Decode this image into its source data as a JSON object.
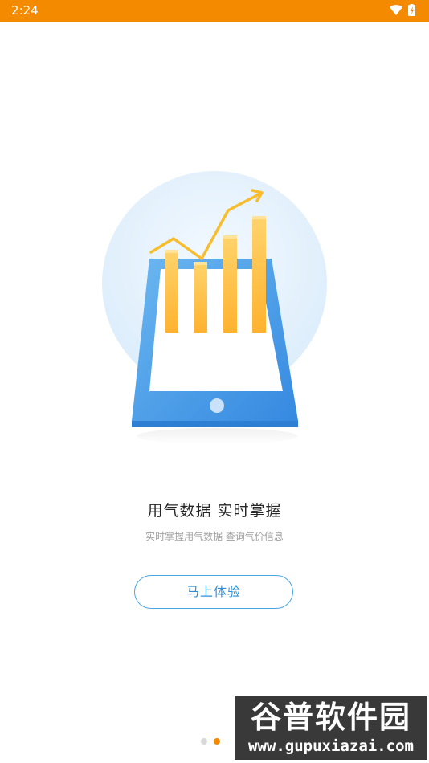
{
  "status_bar": {
    "time": "2:24",
    "bg_color": "#f48a00",
    "icons": [
      "wifi-icon",
      "battery-icon"
    ]
  },
  "hero": {
    "icons": [
      "tablet-icon",
      "bar-chart-icon",
      "trend-arrow-icon"
    ],
    "colors": {
      "circle": "#e3f1fc",
      "tablet": "#4a9be8",
      "bars": "#ffc04d",
      "line": "#f7bd2e"
    }
  },
  "title": "用气数据  实时掌握",
  "subtitle": "实时掌握用气数据 查询气价信息",
  "cta_label": "马上体验",
  "pagination": {
    "count": 2,
    "active_index": 1,
    "active_color": "#f48a00"
  },
  "watermark": {
    "title": "谷普软件园",
    "url": "www.gupuxiazai.com"
  }
}
